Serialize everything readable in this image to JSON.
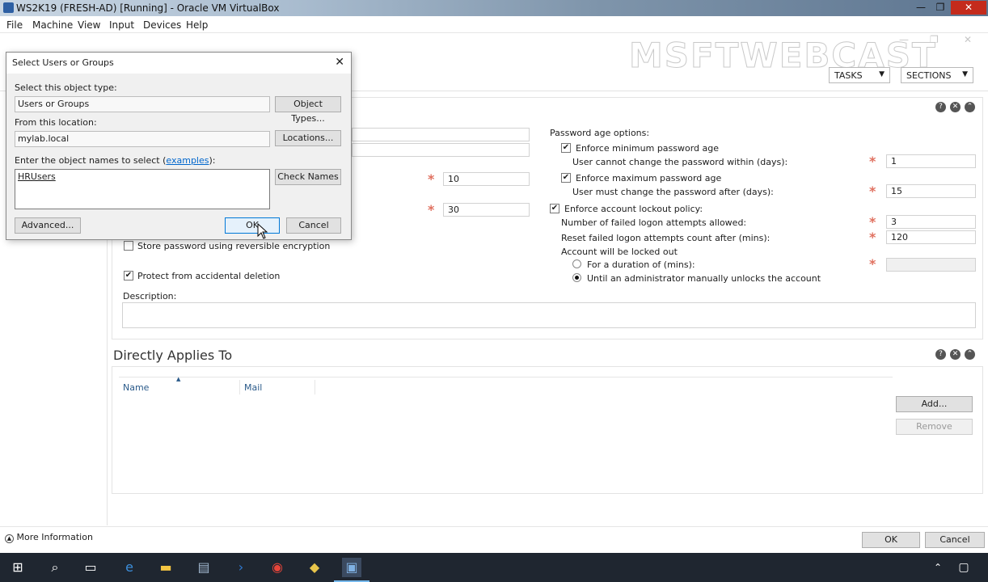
{
  "window": {
    "title": "WS2K19 (FRESH-AD) [Running] - Oracle VM VirtualBox",
    "minimize": "—",
    "maximize": "❐",
    "close": "✕"
  },
  "menu": [
    "File",
    "Machine",
    "View",
    "Input",
    "Devices",
    "Help"
  ],
  "watermark": "MSFTWEBCAST",
  "adac": {
    "tasks": "TASKS",
    "sections": "SECTIONS",
    "password": {
      "field_a": "10",
      "field_b": "30",
      "store_reversible": "Store password using reversible encryption",
      "protect": "Protect from accidental deletion",
      "description_label": "Description:",
      "age_options": "Password age options:",
      "enforce_min": "Enforce minimum password age",
      "min_sub": "User cannot change the password within (days):",
      "min_value": "1",
      "enforce_max": "Enforce maximum password age",
      "max_sub": "User must change the password after (days):",
      "max_value": "15",
      "lockout": "Enforce account lockout policy:",
      "failed_attempts": "Number of failed logon attempts allowed:",
      "failed_value": "3",
      "reset_label": "Reset failed logon attempts count after (mins):",
      "reset_value": "120",
      "locked_out": "Account will be locked out",
      "duration": "For a duration of (mins):",
      "until_admin": "Until an administrator manually unlocks the account"
    },
    "applies": {
      "title": "Directly Applies To",
      "col_name": "Name",
      "col_mail": "Mail",
      "add": "Add...",
      "remove": "Remove"
    },
    "footer": {
      "more_info": "More Information",
      "ok": "OK",
      "cancel": "Cancel"
    }
  },
  "dialog": {
    "title": "Select Users or Groups",
    "object_type_label": "Select this object type:",
    "object_type_value": "Users or Groups",
    "object_types_btn": "Object Types...",
    "location_label": "From this location:",
    "location_value": "mylab.local",
    "locations_btn": "Locations...",
    "names_label_prefix": "Enter the object names to select (",
    "names_label_link": "examples",
    "names_label_suffix": "):",
    "names_value": "HRUsers",
    "check_names": "Check Names",
    "advanced": "Advanced...",
    "ok": "OK",
    "cancel": "Cancel"
  }
}
